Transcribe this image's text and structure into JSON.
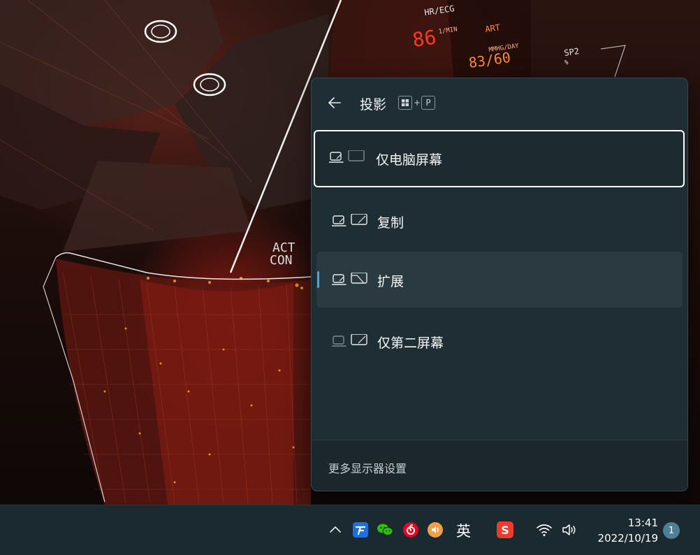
{
  "wallpaper": {
    "hud_texts": [
      "HR/ECG",
      "86",
      "ART",
      "83/60",
      "SP2",
      "%",
      "1/MIN",
      "MMHG/DAY",
      "ACT",
      "CON"
    ]
  },
  "flyout": {
    "title": "投影",
    "shortcut": {
      "key1": "win-key-icon",
      "plus": "+",
      "key2": "P"
    },
    "options": [
      {
        "label": "仅电脑屏幕",
        "state": "focused"
      },
      {
        "label": "复制",
        "state": "normal"
      },
      {
        "label": "扩展",
        "state": "active-hover"
      },
      {
        "label": "仅第二屏幕",
        "state": "normal"
      }
    ],
    "footer_link": "更多显示器设置"
  },
  "taskbar": {
    "ime_label": "英",
    "sogou_label": "S",
    "tray_icons": [
      "chevron-up-icon",
      "tray-app-blue-icon",
      "wechat-icon",
      "netease-music-icon",
      "audio-app-icon",
      "ime-english-icon",
      "sogou-input-icon",
      "wifi-icon",
      "volume-icon"
    ],
    "time": "13:41",
    "date": "2022/10/19",
    "notification_count": "1"
  },
  "colors": {
    "flyout_bg": "#1f2d34",
    "taskbar_bg": "#1b2a30",
    "accent": "#4fa6cf",
    "wechat": "#2dc100",
    "netease": "#e60026",
    "audio_app": "#f0a04b",
    "sogou": "#ef3b2d",
    "tray_blue": "#1e6fe0"
  }
}
